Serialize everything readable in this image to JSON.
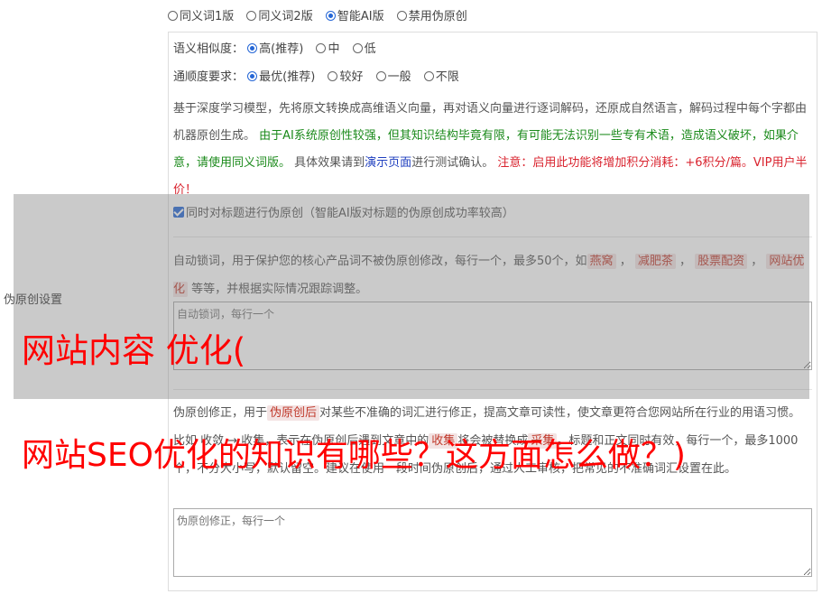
{
  "mode_options": [
    "同义词1版",
    "同义词2版",
    "智能AI版",
    "禁用伪原创"
  ],
  "similarity": {
    "label": "语义相似度：",
    "options": [
      "高(推荐)",
      "中",
      "低"
    ]
  },
  "fluency": {
    "label": "通顺度要求：",
    "options": [
      "最优(推荐)",
      "较好",
      "一般",
      "不限"
    ]
  },
  "description": {
    "part1": "基于深度学习模型，先将原文转换成高维语义向量，再对语义向量进行逐词解码，还原成自然语言，解码过程中每个字都由机器原创生成。",
    "part2": "由于AI系统原创性较强，但其知识结构毕竟有限，有可能无法识别一些专有术语，造成语义破坏，如果介意，请使用同义词版。",
    "part3": "具体效果请到",
    "link": "演示页面",
    "part4": "进行测试确认。",
    "part5": "注意：启用此功能将增加积分消耗：+6积分/篇。VIP用户半价！"
  },
  "settings_label": "伪原创设置",
  "title_check": "同时对标题进行伪原创（智能AI版对标题的伪原创成功率较高）",
  "lock": {
    "text1": "自动锁词，用于保护您的核心产品词不被伪原创修改，每行一个，最多50个，如",
    "tags": [
      "燕窝",
      "减肥茶",
      "股票配资",
      "网站优化"
    ],
    "text2": "等等，并根据实际情况跟踪调整。",
    "placeholder": "自动锁词，每行一个"
  },
  "fix": {
    "text1": "伪原创修正，用于",
    "tag1": "伪原创后",
    "text2": "对某些不准确的词汇进行修正，提高文章可读性，使文章更符合您网站所在行业的用语习惯。比如 收敛 → 收集，表示在伪原创后遇到文章中的",
    "tag2": "收集",
    "text3": "将会被替换成",
    "tag3": "采集",
    "text4": "。标题和正文同时有效，每行一个，最多1000个，不分大小写，默认留空。建议在使用一段时间伪原创后，通过人工审核，把常见的不准确词汇设置在此。",
    "placeholder": "伪原创修正，每行一个"
  },
  "overlay": {
    "line1": "网站内容 优化(",
    "line2": "网站SEO优化的知识有哪些？这方面怎么做？)"
  },
  "colors": {
    "accent": "#2466d6",
    "overlay_text": "#ff0000",
    "green": "#1b8a1b",
    "red": "#d9232e"
  }
}
